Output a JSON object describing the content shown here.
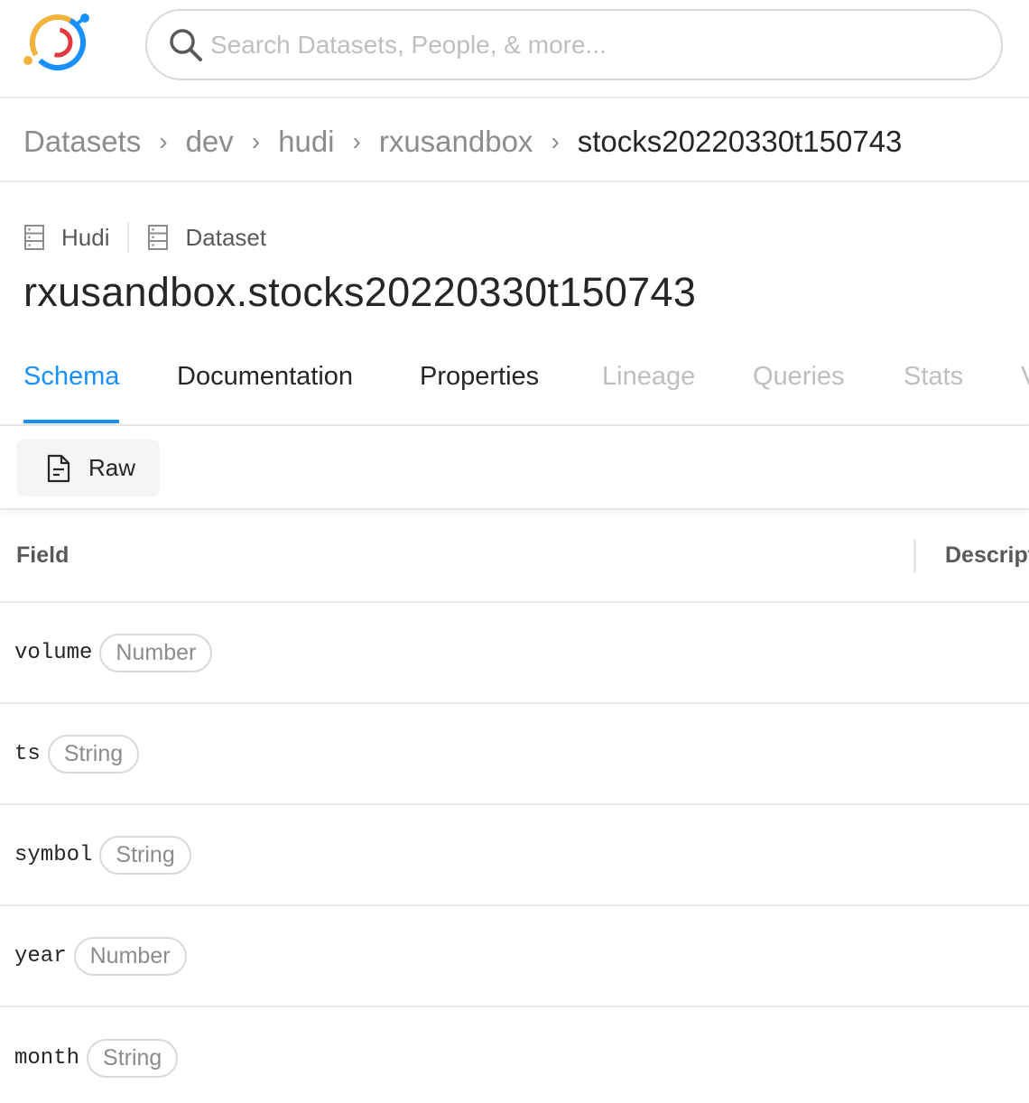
{
  "header": {
    "search_placeholder": "Search Datasets, People, & more..."
  },
  "breadcrumb": {
    "items": [
      "Datasets",
      "dev",
      "hudi",
      "rxusandbox",
      "stocks20220330t150743"
    ],
    "separator": "›"
  },
  "entity": {
    "platform": "Hudi",
    "type": "Dataset",
    "title": "rxusandbox.stocks20220330t150743"
  },
  "tabs": [
    {
      "label": "Schema",
      "state": "active"
    },
    {
      "label": "Documentation",
      "state": "enabled"
    },
    {
      "label": "Properties",
      "state": "enabled"
    },
    {
      "label": "Lineage",
      "state": "disabled"
    },
    {
      "label": "Queries",
      "state": "disabled"
    },
    {
      "label": "Stats",
      "state": "disabled"
    },
    {
      "label": "V",
      "state": "disabled"
    }
  ],
  "toolbar": {
    "raw_label": "Raw"
  },
  "table": {
    "columns": [
      "Field",
      "Descript"
    ],
    "rows": [
      {
        "field": "volume",
        "type": "Number"
      },
      {
        "field": "ts",
        "type": "String"
      },
      {
        "field": "symbol",
        "type": "String"
      },
      {
        "field": "year",
        "type": "Number"
      },
      {
        "field": "month",
        "type": "String"
      }
    ]
  },
  "colors": {
    "accent": "#1890ff",
    "border": "#e8e8e8",
    "muted_text": "#8c8c8c",
    "disabled_text": "#bfbfbf"
  },
  "icons": {
    "logo": "datahub-logo",
    "search": "search-icon",
    "platform": "database-icon",
    "raw": "file-text-icon"
  }
}
